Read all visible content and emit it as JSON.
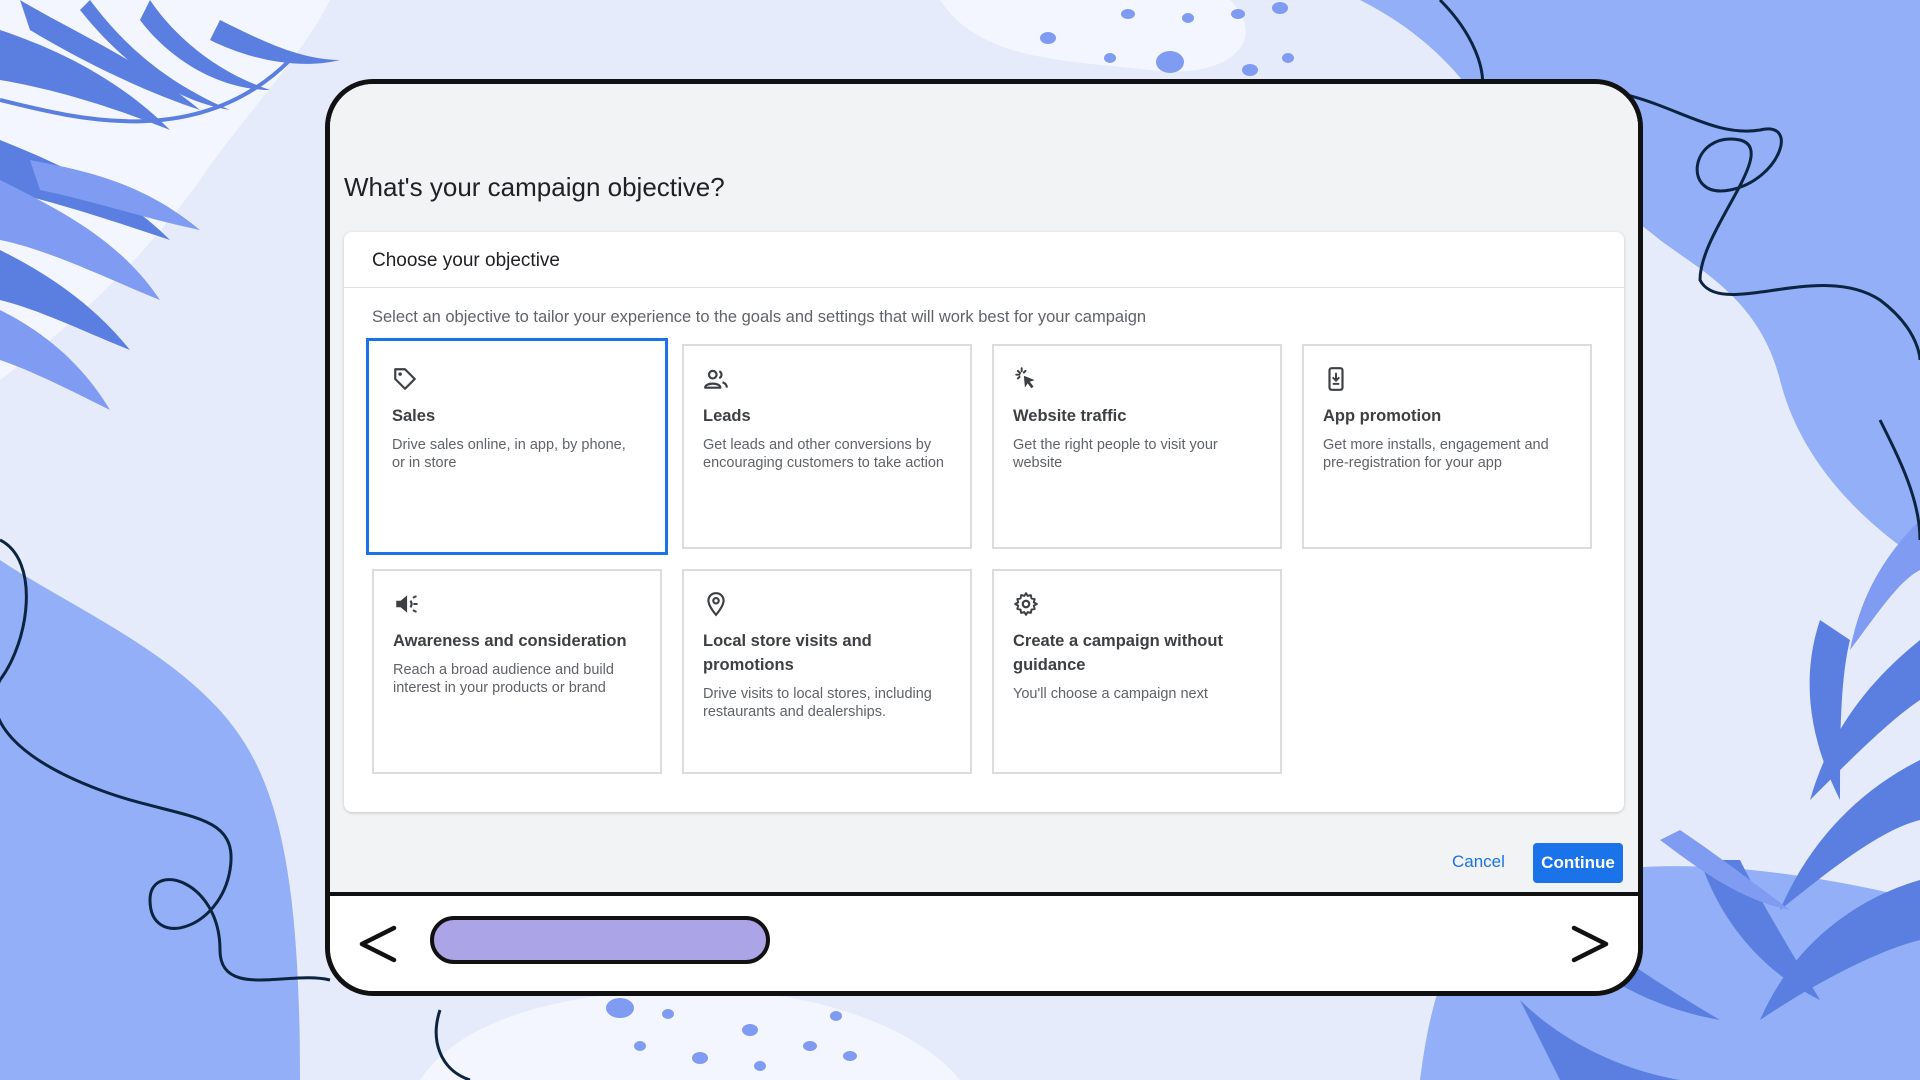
{
  "window": {
    "controls": [
      "close-icon",
      "restore-icon",
      "minimize-icon"
    ]
  },
  "page": {
    "title": "What's your campaign objective?"
  },
  "card": {
    "header": "Choose your objective",
    "description": "Select an objective to tailor your experience to the goals and settings that will work best for your campaign"
  },
  "objectives": [
    {
      "icon": "tag-icon",
      "title": "Sales",
      "desc": "Drive sales online, in app, by phone, or in store",
      "selected": true
    },
    {
      "icon": "people-icon",
      "title": "Leads",
      "desc": "Get leads and other conversions by encouraging customers to take action",
      "selected": false
    },
    {
      "icon": "cursor-click-icon",
      "title": "Website traffic",
      "desc": "Get the right people to visit your website",
      "selected": false
    },
    {
      "icon": "phone-download-icon",
      "title": "App promotion",
      "desc": "Get more installs, engagement and pre-registration for your app",
      "selected": false
    },
    {
      "icon": "megaphone-icon",
      "title": "Awareness and consideration",
      "desc": "Reach a broad audience and build interest in your products or brand",
      "selected": false
    },
    {
      "icon": "location-pin-icon",
      "title": "Local store visits and promotions",
      "desc": "Drive visits to local stores, including restaurants and dealerships.",
      "selected": false
    },
    {
      "icon": "gear-icon",
      "title": "Create a campaign without guidance",
      "desc": "You'll choose a campaign next",
      "selected": false
    }
  ],
  "actions": {
    "cancel_label": "Cancel",
    "continue_label": "Continue"
  },
  "footer": {
    "back_icon": "chevron-left-icon",
    "forward_icon": "chevron-right-icon"
  },
  "colors": {
    "accent": "#1a73e8",
    "titlebar": "#aba5e8",
    "background": "#e6ebfb",
    "decor_blue": "#7f9bf2"
  }
}
